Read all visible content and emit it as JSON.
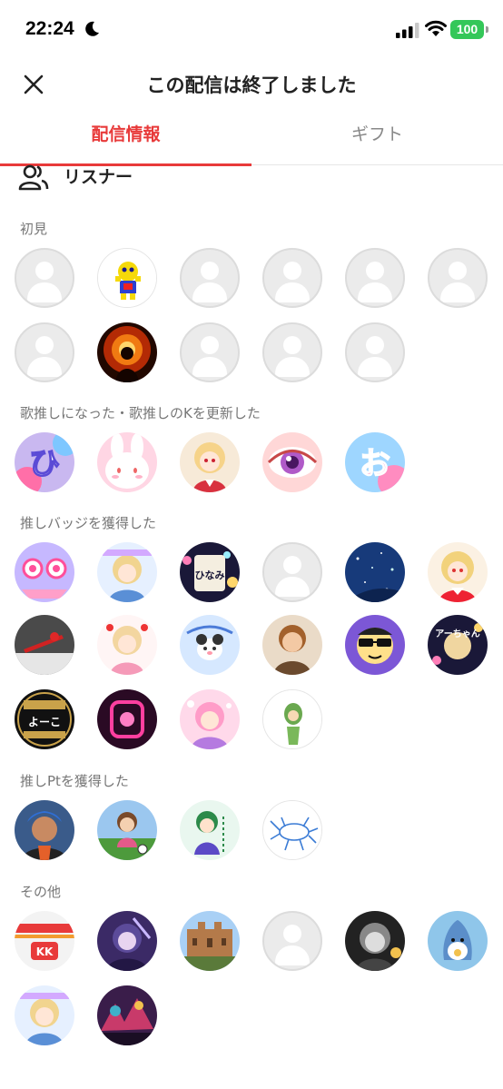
{
  "status": {
    "time": "22:24",
    "battery": "100"
  },
  "header": {
    "title": "この配信は終了しました"
  },
  "tabs": [
    {
      "label": "配信情報"
    },
    {
      "label": "ギフト"
    }
  ],
  "listener": {
    "label": "リスナー"
  },
  "sections": [
    {
      "title": "初見"
    },
    {
      "title": "歌推しになった・歌推しのKを更新した"
    },
    {
      "title": "推しバッジを獲得した"
    },
    {
      "title": "推しPtを獲得した"
    },
    {
      "title": "その他"
    }
  ],
  "avatar_badges": {
    "a": "ひ",
    "b": "お",
    "c": "ひなみ",
    "d": "よーこ",
    "e": "アーちゃん",
    "f": "KK"
  },
  "colors": {
    "accent": "#e83a3a",
    "battery": "#34c759",
    "placeholder": "#ebebeb"
  }
}
